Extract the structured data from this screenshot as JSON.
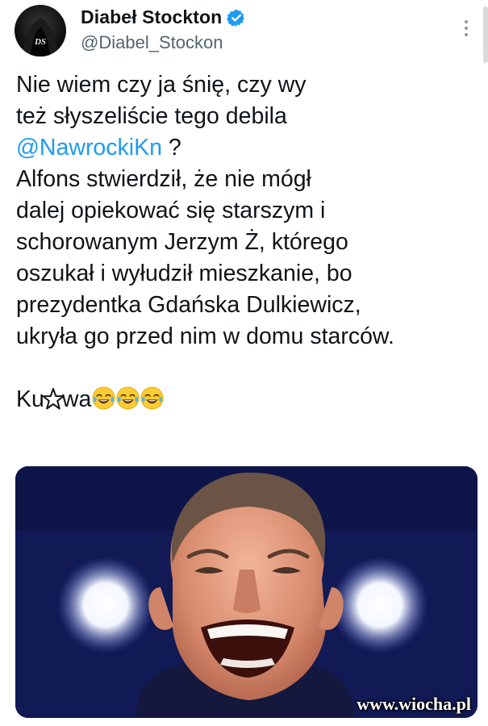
{
  "author": {
    "display_name": "Diabeł Stockton",
    "handle": "@Diabel_Stockon",
    "avatar_initials": "DS",
    "verified": true
  },
  "tweet": {
    "line1": "Nie wiem czy ja śnię, czy wy",
    "line2": "też słyszeliście tego debila",
    "mention": "@NawrockiKn",
    "mention_suffix": " ?",
    "line4": "Alfons stwierdził, że nie mógł",
    "line5": "dalej opiekować się starszym i",
    "line6": "schorowanym Jerzym Ż, którego",
    "line7": "oszukał i wyłudził mieszkanie, bo",
    "line8": "prezydentka Gdańska Dulkiewicz,",
    "line9": "ukryła go przed nim w domu starców.",
    "last_prefix": "Ku",
    "last_suffix": "wa",
    "emojis": [
      "face-with-tears-of-joy-icon",
      "face-with-tears-of-joy-icon",
      "face-with-tears-of-joy-icon"
    ]
  },
  "media": {
    "watermark": "www.wiocha.pl"
  },
  "colors": {
    "text": "#0f1419",
    "secondary": "#536471",
    "link": "#1d9bf0",
    "verified": "#1d9bf0",
    "media_bg": "#15206a"
  }
}
